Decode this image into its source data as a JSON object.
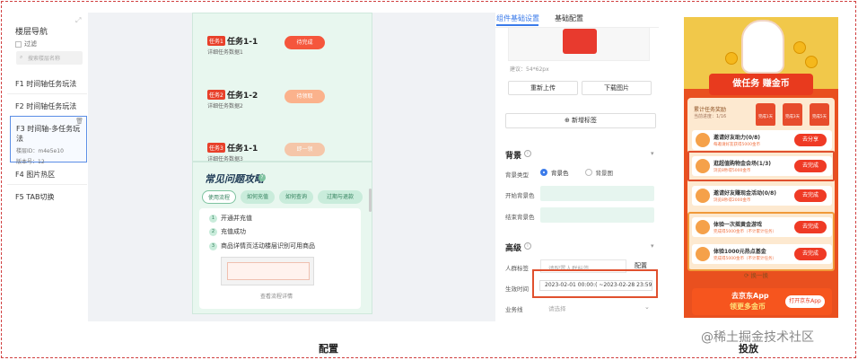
{
  "nav": {
    "title": "楼层导航",
    "filter_label": "过滤",
    "search_placeholder": "搜索楼层名称",
    "items": [
      "F1 时间轴任务玩法",
      "F2 时间轴任务玩法",
      "F4 图片热区",
      "F5 TAB切换"
    ],
    "active": {
      "title": "F3 时间轴-多任务玩法",
      "id_line": "楼层ID：m4e5e10",
      "version_line": "版本号：12"
    }
  },
  "tasks": [
    {
      "tag": "任务1",
      "name": "任务1-1",
      "desc": "详细任务数据1",
      "btn": "待完成"
    },
    {
      "tag": "任务2",
      "name": "任务1-2",
      "desc": "详细任务数据2",
      "btn": "待领取"
    },
    {
      "tag": "任务3",
      "name": "任务1-1",
      "desc": "详细任务数据3",
      "btn": "即一领"
    }
  ],
  "faq": {
    "title": "常见问题攻略",
    "tabs": [
      "使用流程",
      "如何充值",
      "如何查询",
      "过期与退款"
    ],
    "steps": [
      "开通并充值",
      "充值成功",
      "商品详情页活动楼层识别可用商品"
    ],
    "link": "查看流程详情"
  },
  "panel": {
    "tabs": [
      "组件基础设置",
      "基础配置"
    ],
    "hint": "建议：54*62px",
    "reupload": "重新上传",
    "download": "下载图片",
    "add_tag": "⊕ 新增标签",
    "bg_title": "背景",
    "bg_type_label": "背景类型",
    "bg_color_opt": "背景色",
    "bg_image_opt": "背景图",
    "start_color_label": "开始背景色",
    "end_color_label": "结束背景色",
    "adv_title": "高级",
    "crowd_label": "人群标签",
    "crowd_placeholder": "请配置人群标签",
    "config_btn": "配置",
    "time_label": "生效时间",
    "time_value": "2023-02-01 00:00:( ~2023-02-28 23:59:",
    "biz_label": "业务线",
    "biz_placeholder": "请选择"
  },
  "phone": {
    "banner": "做任务 赚金币",
    "reward_title": "累计任务奖励",
    "reward_sub": "当前进度：1/16",
    "mini_labels": [
      "完成1天",
      "完成3天",
      "完成5天"
    ],
    "tasks": [
      {
        "a": "邀请好友助力(0/8)",
        "b": "每邀请好友获得5000金币",
        "go": "去分享"
      },
      {
        "a": "逛超值购物金会场(1/3)",
        "b": "浏览8秒得5000金币",
        "go": "去完成"
      },
      {
        "a": "邀请好友赚现金活动(0/8)",
        "b": "浏览8秒得2000金币",
        "go": "去完成"
      },
      {
        "a": "体验一次摇黄金游戏",
        "b": "完成得5000金币（不计累计任务）",
        "go": "去完成"
      },
      {
        "a": "体验1000元热点基金",
        "b": "完成得5000金币（不计累计任务）",
        "go": "去完成"
      }
    ],
    "more": "⟳ 换一换",
    "app_a": "去京东App",
    "app_b": "领更多金币",
    "app_go": "打开京东App"
  },
  "captions": {
    "config": "配置",
    "deliver": "投放"
  },
  "watermark": "@稀土掘金技术社区"
}
